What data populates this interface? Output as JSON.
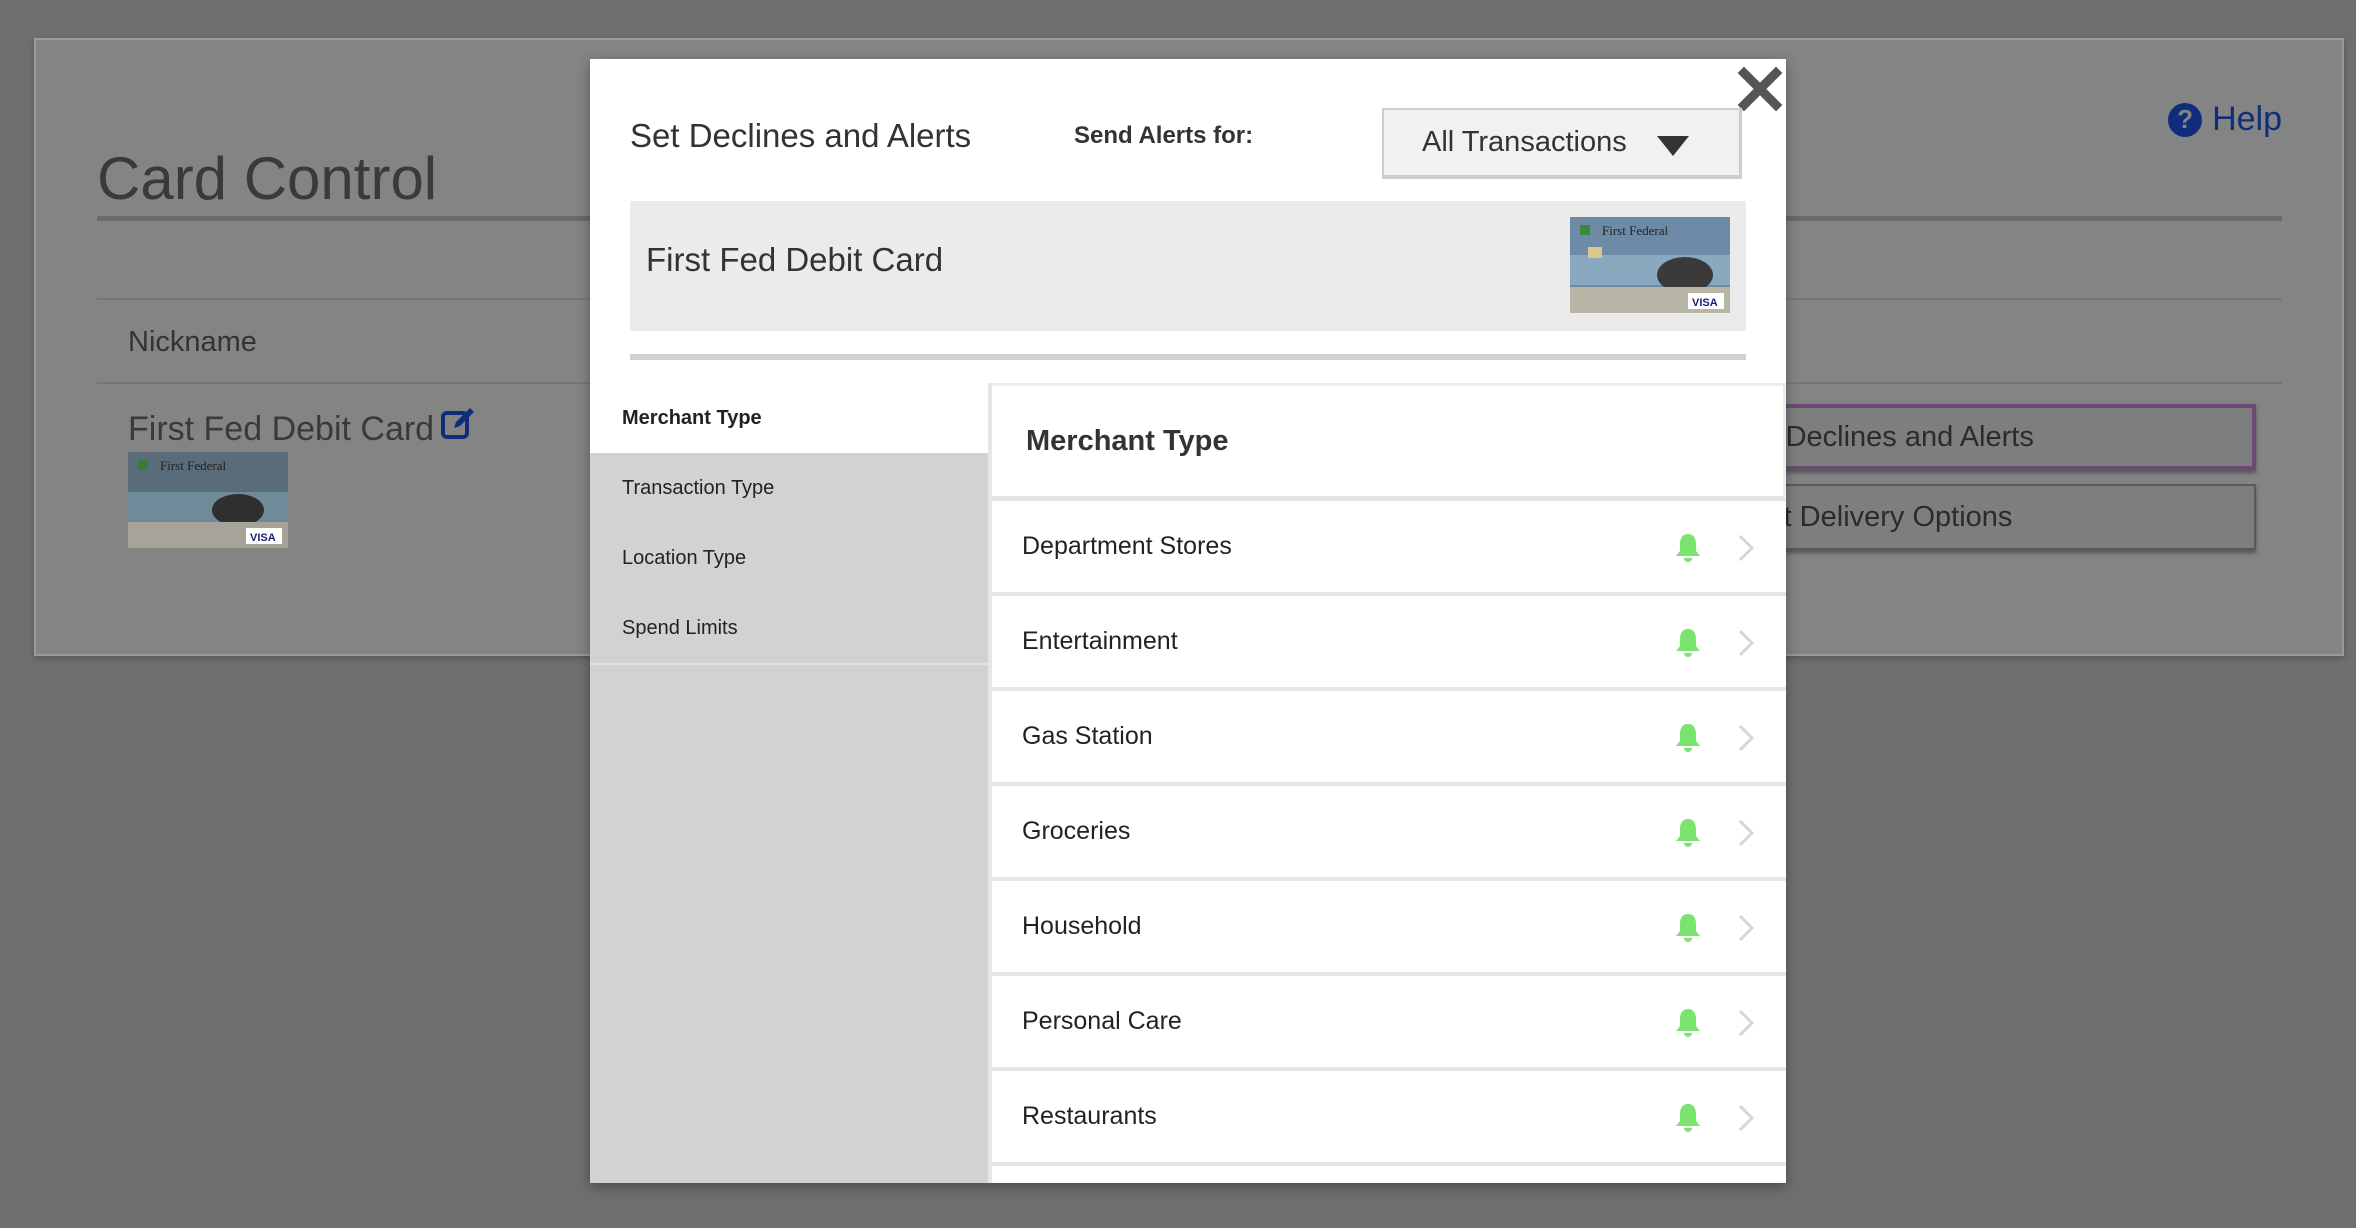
{
  "page": {
    "title": "Card Control",
    "help_label": "Help",
    "nickname_label": "Nickname",
    "card_nickname": "First Fed Debit Card",
    "buttons": {
      "set_declines": "Set Declines and Alerts",
      "alert_delivery": "Alert Delivery Options"
    }
  },
  "card_image": {
    "brand_text": "First Federal",
    "network": "VISA"
  },
  "modal": {
    "title": "Set Declines and Alerts",
    "send_alerts_label": "Send Alerts for:",
    "send_alerts_value": "All Transactions",
    "card_name": "First Fed Debit Card",
    "nav": [
      {
        "label": "Merchant Type",
        "active": true
      },
      {
        "label": "Transaction Type",
        "active": false
      },
      {
        "label": "Location Type",
        "active": false
      },
      {
        "label": "Spend Limits",
        "active": false
      }
    ],
    "section_title": "Merchant Type",
    "merchants": [
      {
        "label": "Department Stores"
      },
      {
        "label": "Entertainment"
      },
      {
        "label": "Gas Station"
      },
      {
        "label": "Groceries"
      },
      {
        "label": "Household"
      },
      {
        "label": "Personal Care"
      },
      {
        "label": "Restaurants"
      }
    ]
  },
  "colors": {
    "overlay": "#6f6f6f",
    "bell": "#7be36f",
    "help": "#0f2d7a"
  }
}
